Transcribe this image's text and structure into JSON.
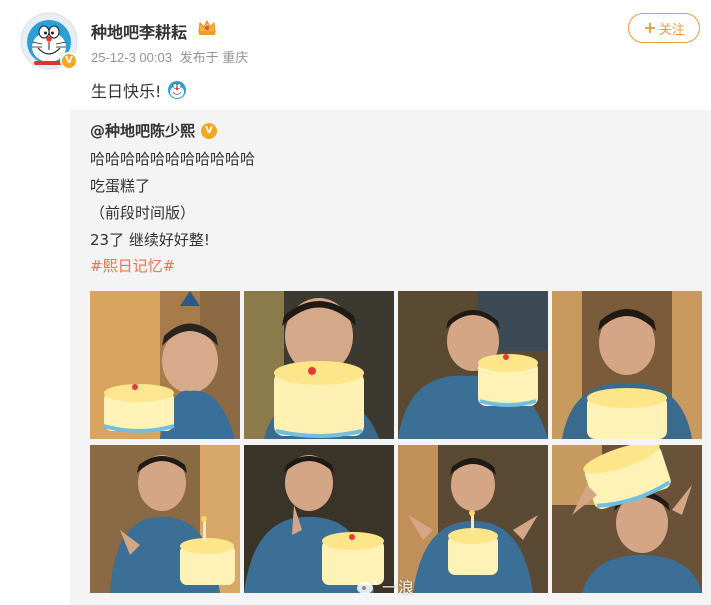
{
  "post": {
    "username": "种地吧李耕耘",
    "timestamp": "25-12-3 00:03",
    "location": "发布于 重庆",
    "text": "生日快乐!",
    "follow_label": "关注",
    "follow_plus": "+"
  },
  "repost": {
    "username": "@种地吧陈少熙",
    "lines": [
      "哈哈哈哈哈哈哈哈哈哈哈",
      "吃蛋糕了",
      "（前段时间版）",
      "23了 继续好好整!"
    ],
    "hashtag": "#熙日记忆#"
  },
  "badge_text": "V",
  "watermark": "一浪",
  "colors": {
    "accent": "#f09a3b",
    "hashtag": "#eb7350",
    "repost_bg": "#f4f4f4",
    "meta": "#939393"
  },
  "icons": [
    "doraemon-avatar",
    "crown-icon",
    "doraemon-emoji",
    "verified-badge",
    "weibo-logo"
  ]
}
